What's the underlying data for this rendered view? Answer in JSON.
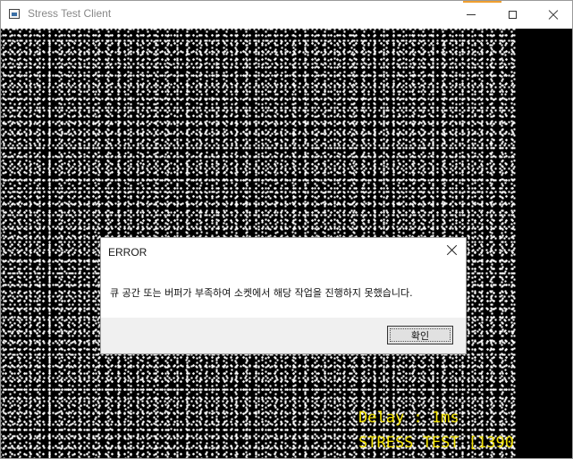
{
  "window": {
    "title": "Stress Test Client",
    "accent_color": "#f0a030",
    "controls": {
      "minimize_icon": "minimize-icon",
      "maximize_icon": "maximize-icon",
      "close_icon": "close-icon"
    }
  },
  "canvas": {
    "background_color": "#000000",
    "noise_color": "#ffffff",
    "overlay_color": "#f0e000",
    "delay_text": "Delay : 1ms",
    "stress_text": "STRESS TEST [1390"
  },
  "dialog": {
    "title": "ERROR",
    "message": "큐 공간 또는 버퍼가 부족하여 소켓에서 해당 작업을 진행하지 못했습니다.",
    "ok_label": "확인",
    "close_icon": "close-icon"
  }
}
